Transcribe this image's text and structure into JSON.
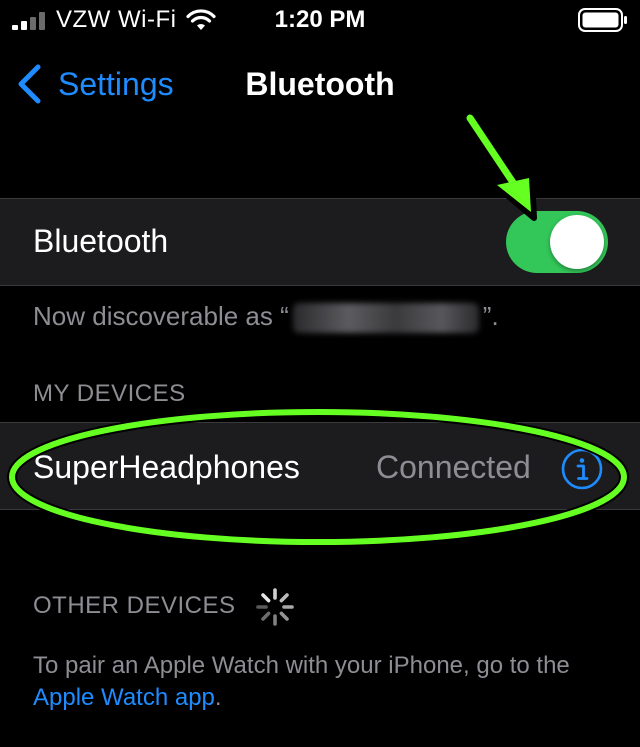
{
  "status_bar": {
    "carrier": "VZW Wi-Fi",
    "time": "1:20 PM",
    "icons": [
      "cellular-signal-icon",
      "wifi-icon",
      "battery-icon"
    ]
  },
  "nav": {
    "back_label": "Settings",
    "title": "Bluetooth"
  },
  "bluetooth": {
    "label": "Bluetooth",
    "enabled": true,
    "discoverable_prefix": "Now discoverable as “",
    "discoverable_suffix": "”."
  },
  "my_devices": {
    "header": "MY DEVICES",
    "items": [
      {
        "name": "SuperHeadphones",
        "status": "Connected",
        "icon": "info-icon"
      }
    ]
  },
  "other_devices": {
    "header": "OTHER DEVICES",
    "footer_text": "To pair an Apple Watch with your iPhone, go to the ",
    "footer_link": "Apple Watch app",
    "footer_end": "."
  },
  "colors": {
    "accent": "#1e8cff",
    "toggle_on": "#33c659",
    "annotation": "#66ff22",
    "cell_bg": "#1c1c1e",
    "secondary_text": "#8d8d93"
  }
}
